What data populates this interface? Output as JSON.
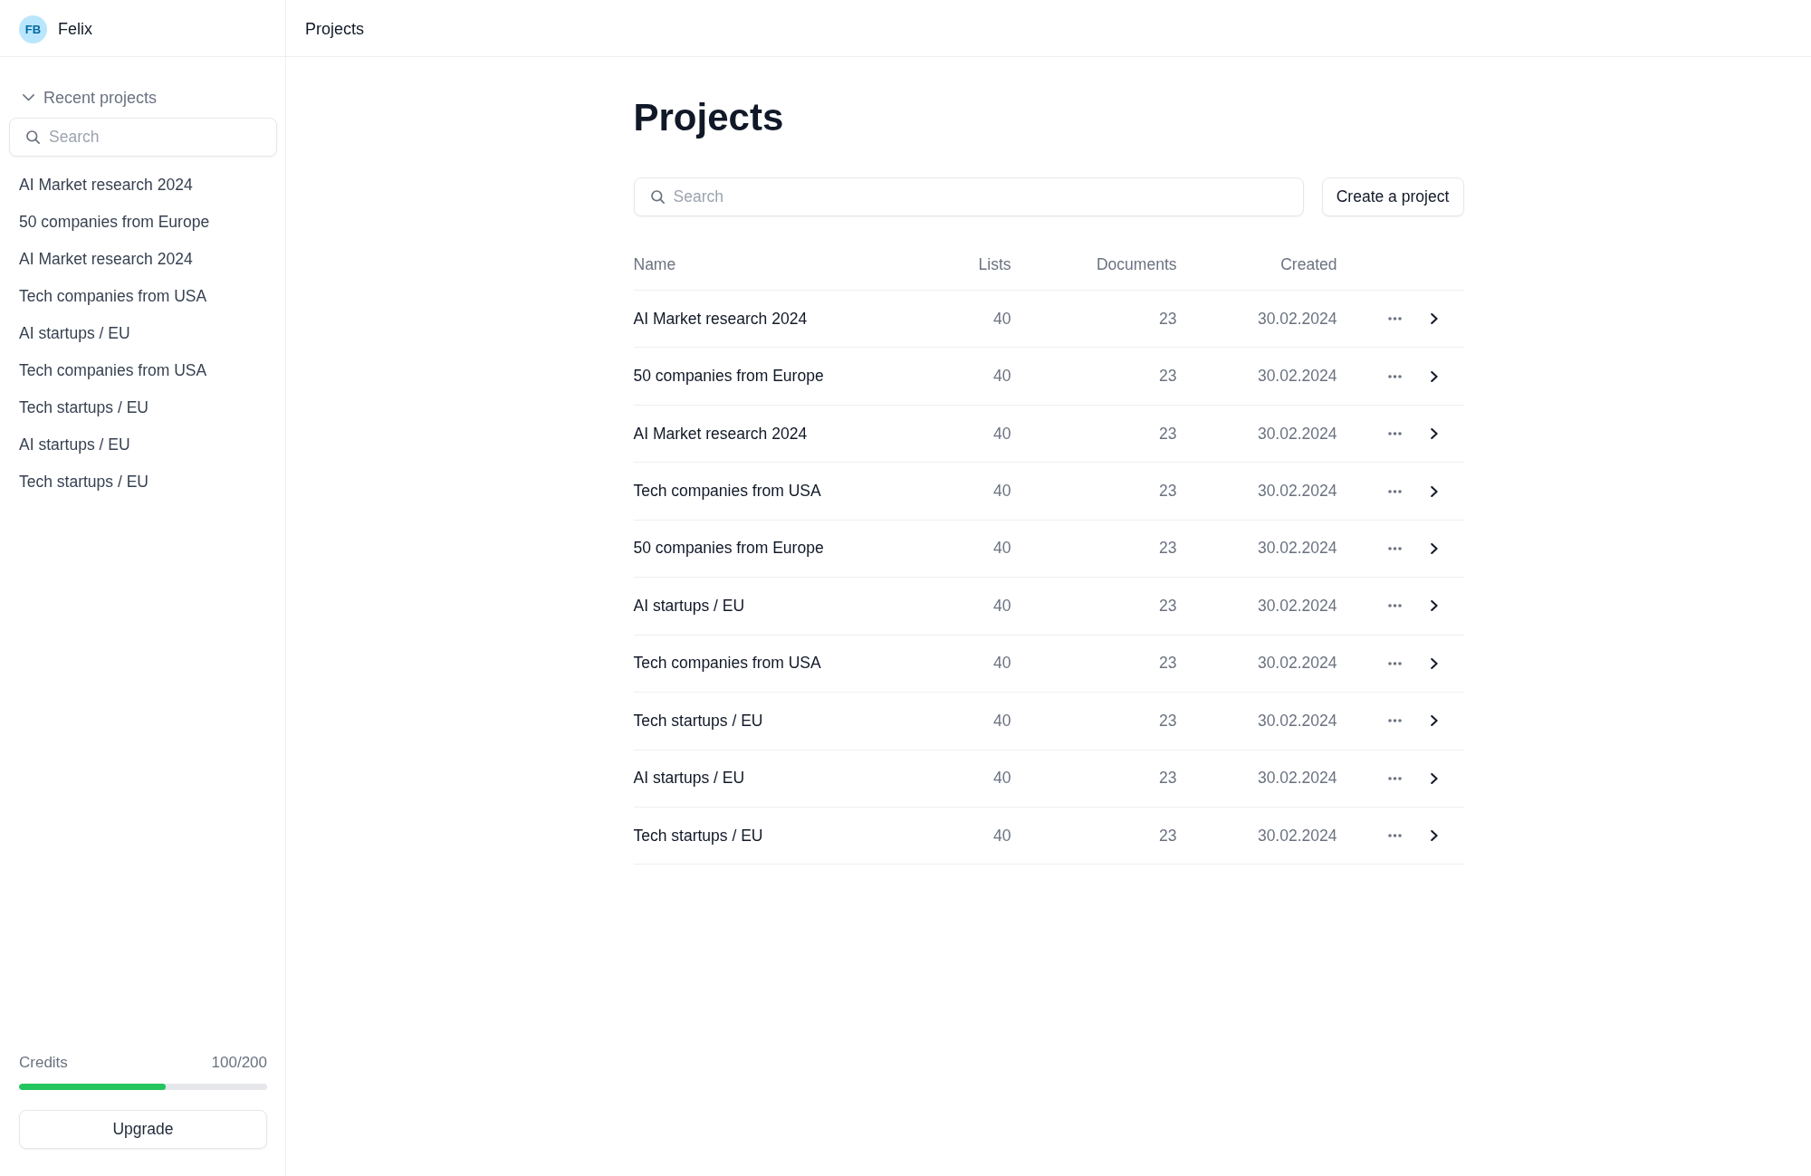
{
  "user": {
    "initials": "FB",
    "name": "Felix"
  },
  "sidebar": {
    "recent_projects": {
      "label": "Recent projects",
      "expanded": true,
      "search": {
        "placeholder": "Search"
      },
      "items": [
        "AI Market research 2024",
        "50 companies from Europe",
        "AI Market research 2024",
        "Tech companies from USA",
        "AI startups / EU",
        "Tech companies from USA",
        "Tech startups / EU",
        "AI startups / EU",
        "Tech startups / EU"
      ]
    },
    "credits": {
      "label": "Credits",
      "reading": "100/200",
      "level": 0.59
    },
    "upgrade_button": "Upgrade"
  },
  "header": {
    "breadcrumb": "Projects"
  },
  "main": {
    "title": "Projects",
    "search": {
      "placeholder": "Search"
    },
    "create_button": "Create a project",
    "table": {
      "columns": [
        "Name",
        "Lists",
        "Documents",
        "Created"
      ],
      "rows": [
        {
          "name": "AI Market research 2024",
          "lists": "40",
          "documents": "23",
          "created": "30.02.2024"
        },
        {
          "name": "50 companies from Europe",
          "lists": "40",
          "documents": "23",
          "created": "30.02.2024"
        },
        {
          "name": "AI Market research 2024",
          "lists": "40",
          "documents": "23",
          "created": "30.02.2024"
        },
        {
          "name": "Tech companies from USA",
          "lists": "40",
          "documents": "23",
          "created": "30.02.2024"
        },
        {
          "name": "50 companies from Europe",
          "lists": "40",
          "documents": "23",
          "created": "30.02.2024"
        },
        {
          "name": "AI startups / EU",
          "lists": "40",
          "documents": "23",
          "created": "30.02.2024"
        },
        {
          "name": "Tech companies from USA",
          "lists": "40",
          "documents": "23",
          "created": "30.02.2024"
        },
        {
          "name": "Tech startups / EU",
          "lists": "40",
          "documents": "23",
          "created": "30.02.2024"
        },
        {
          "name": "AI startups / EU",
          "lists": "40",
          "documents": "23",
          "created": "30.02.2024"
        },
        {
          "name": "Tech startups / EU",
          "lists": "40",
          "documents": "23",
          "created": "30.02.2024"
        }
      ]
    }
  }
}
